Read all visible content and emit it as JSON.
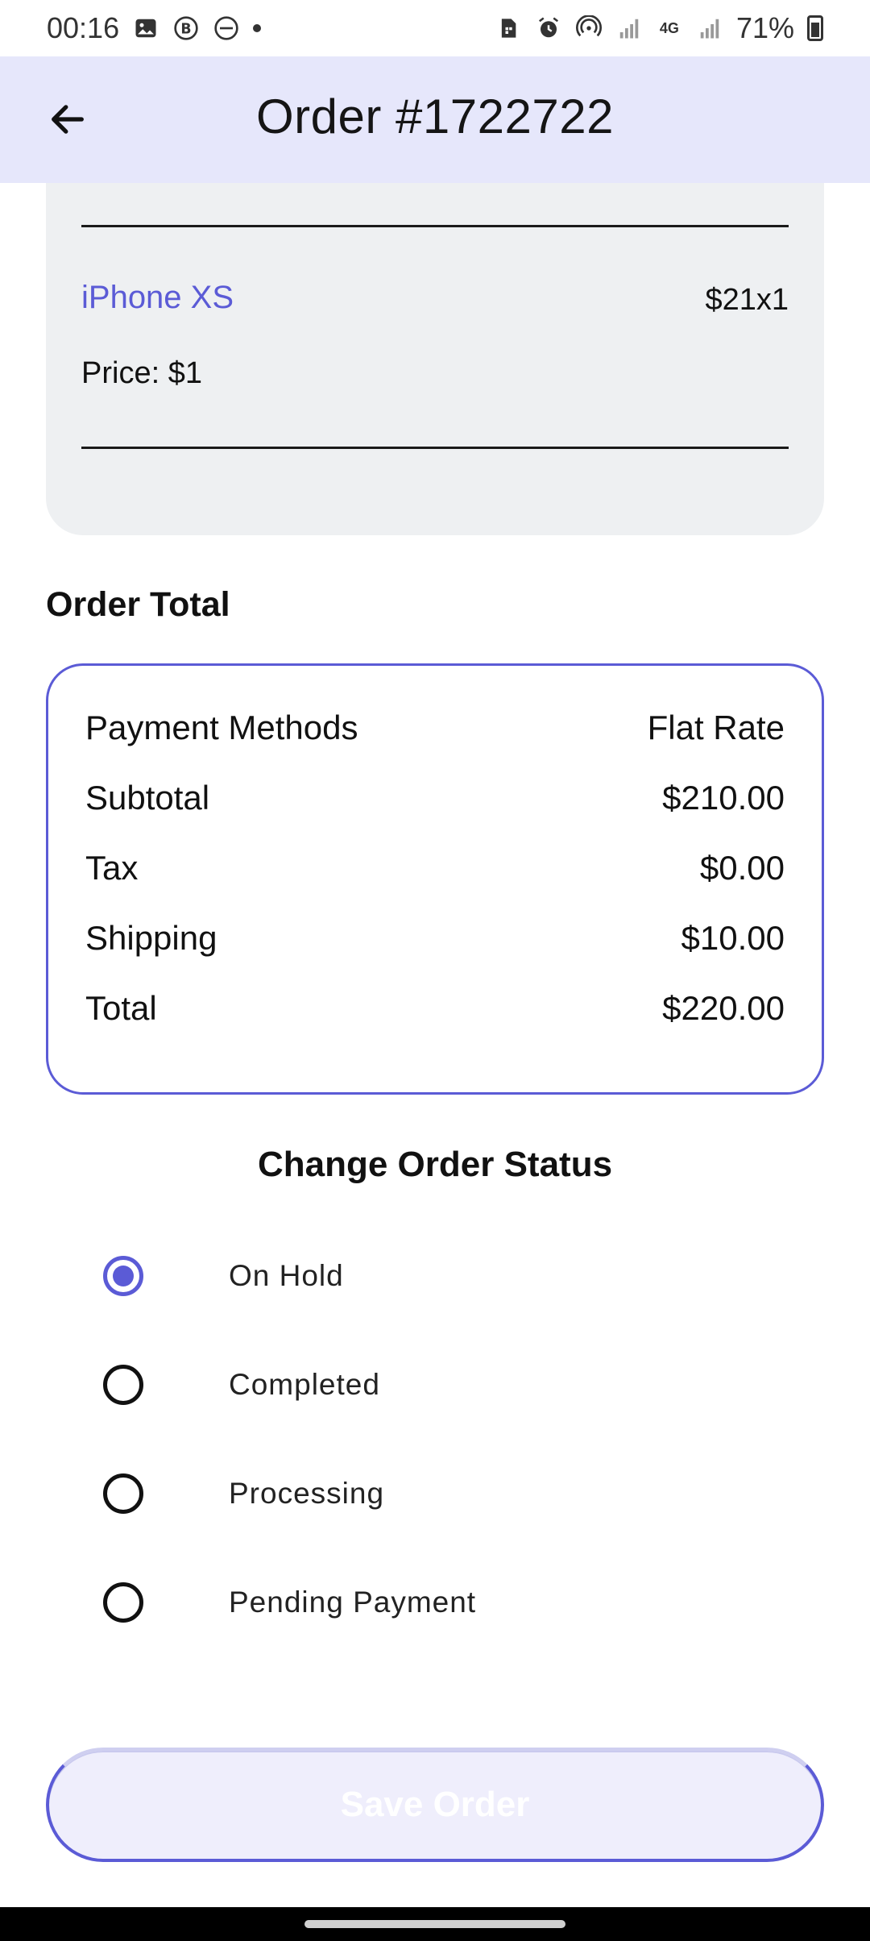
{
  "status_bar": {
    "time": "00:16",
    "battery": "71%",
    "icons_left": [
      "image-icon",
      "b-circle-icon",
      "dnd-icon",
      "dot-icon"
    ],
    "icons_right": [
      "sim-icon",
      "alarm-icon",
      "hotspot-icon",
      "signal-icon",
      "4g-icon",
      "signal-icon",
      "battery-icon"
    ]
  },
  "app_bar": {
    "title": "Order #1722722",
    "back_icon": "arrow-left-icon"
  },
  "product": {
    "name": "iPhone XS",
    "qty": "$21x1",
    "price": "Price: $1"
  },
  "order_total": {
    "title": "Order Total",
    "rows": [
      {
        "label": "Payment Methods",
        "value": "Flat Rate"
      },
      {
        "label": "Subtotal",
        "value": "$210.00"
      },
      {
        "label": "Tax",
        "value": "$0.00"
      },
      {
        "label": "Shipping",
        "value": "$10.00"
      },
      {
        "label": "Total",
        "value": "$220.00"
      }
    ]
  },
  "status_section": {
    "title": "Change Order Status",
    "options": [
      {
        "label": "On Hold",
        "selected": true
      },
      {
        "label": "Completed",
        "selected": false
      },
      {
        "label": "Processing",
        "selected": false
      },
      {
        "label": "Pending Payment",
        "selected": false
      }
    ]
  },
  "save_button": {
    "label": "Save Order"
  },
  "colors": {
    "accent": "#5b5bd6",
    "app_bar_bg": "#e6e7fb",
    "card_bg": "#eef0f2"
  }
}
